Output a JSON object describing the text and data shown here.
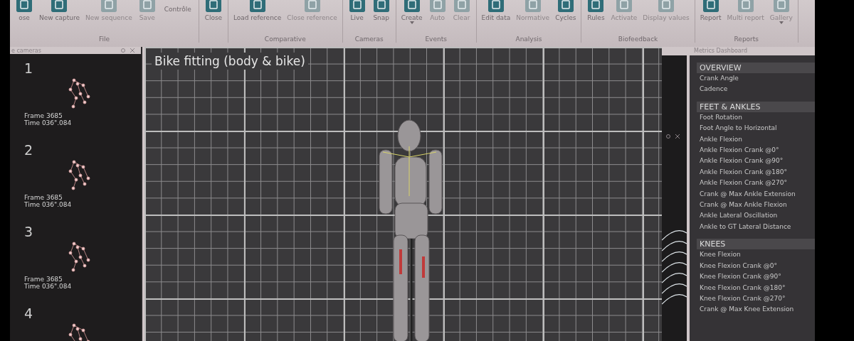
{
  "ribbon": {
    "groups": [
      {
        "label": "File",
        "note": "Contrôle",
        "buttons": [
          {
            "label": "ose",
            "disabled": false,
            "has_menu": false
          },
          {
            "label": "New capture",
            "disabled": false,
            "has_menu": false
          },
          {
            "label": "New sequence",
            "disabled": true,
            "has_menu": false
          },
          {
            "label": "Save",
            "disabled": true,
            "has_menu": false
          }
        ]
      },
      {
        "buttons": [
          {
            "label": "Close",
            "disabled": false,
            "has_menu": false
          }
        ]
      },
      {
        "label": "Comparative",
        "buttons": [
          {
            "label": "Load reference",
            "disabled": false,
            "has_menu": false
          },
          {
            "label": "Close reference",
            "disabled": true,
            "has_menu": false
          }
        ]
      },
      {
        "label": "Cameras",
        "buttons": [
          {
            "label": "Live",
            "disabled": false,
            "has_menu": false
          },
          {
            "label": "Snap",
            "disabled": false,
            "has_menu": false
          }
        ]
      },
      {
        "label": "Events",
        "buttons": [
          {
            "label": "Create",
            "disabled": false,
            "has_menu": true
          },
          {
            "label": "Auto",
            "disabled": true,
            "has_menu": false
          },
          {
            "label": "Clear",
            "disabled": true,
            "has_menu": false
          }
        ]
      },
      {
        "label": "Analysis",
        "buttons": [
          {
            "label": "Edit data",
            "disabled": false,
            "has_menu": false
          },
          {
            "label": "Normative",
            "disabled": true,
            "has_menu": false
          },
          {
            "label": "Cycles",
            "disabled": false,
            "has_menu": false
          }
        ]
      },
      {
        "label": "Biofeedback",
        "buttons": [
          {
            "label": "Rules",
            "disabled": false,
            "has_menu": false
          },
          {
            "label": "Activate",
            "disabled": true,
            "has_menu": false
          },
          {
            "label": "Display values",
            "disabled": true,
            "has_menu": false
          }
        ]
      },
      {
        "label": "Reports",
        "buttons": [
          {
            "label": "Report",
            "disabled": false,
            "has_menu": false
          },
          {
            "label": "Multi report",
            "disabled": true,
            "has_menu": false
          },
          {
            "label": "Gallery",
            "disabled": true,
            "has_menu": true
          }
        ]
      }
    ]
  },
  "cameras_panel": {
    "title": "e cameras",
    "cameras": [
      {
        "number": "1",
        "frame": "Frame 3685",
        "time": "Time 036\".084"
      },
      {
        "number": "2",
        "frame": "Frame 3685",
        "time": "Time 036\".084"
      },
      {
        "number": "3",
        "frame": "Frame 3685",
        "time": "Time 036\".084"
      },
      {
        "number": "4"
      }
    ]
  },
  "viewport": {
    "title": "Bike fitting (body & bike)"
  },
  "metrics_panel": {
    "title": "Metrics Dashboard",
    "sections": [
      {
        "heading": "OVERVIEW",
        "items": [
          "Crank Angle",
          "Cadence"
        ]
      },
      {
        "heading": "FEET & ANKLES",
        "items": [
          "Foot Rotation",
          "Foot Angle to Horizontal",
          "Ankle Flexion",
          "Ankle Flexion Crank @0°",
          "Ankle Flexion Crank @90°",
          "Ankle Flexion Crank @180°",
          "Ankle Flexion Crank @270°",
          "Crank @ Max Ankle Extension",
          "Crank @ Max Ankle Flexion",
          "Ankle Lateral Oscillation",
          "Ankle to GT Lateral Distance"
        ]
      },
      {
        "heading": "KNEES",
        "items": [
          "Knee Flexion",
          "Knee Flexion Crank @0°",
          "Knee Flexion Crank @90°",
          "Knee Flexion Crank @180°",
          "Knee Flexion Crank @270°",
          "Crank @ Max Knee Extension"
        ]
      }
    ]
  }
}
